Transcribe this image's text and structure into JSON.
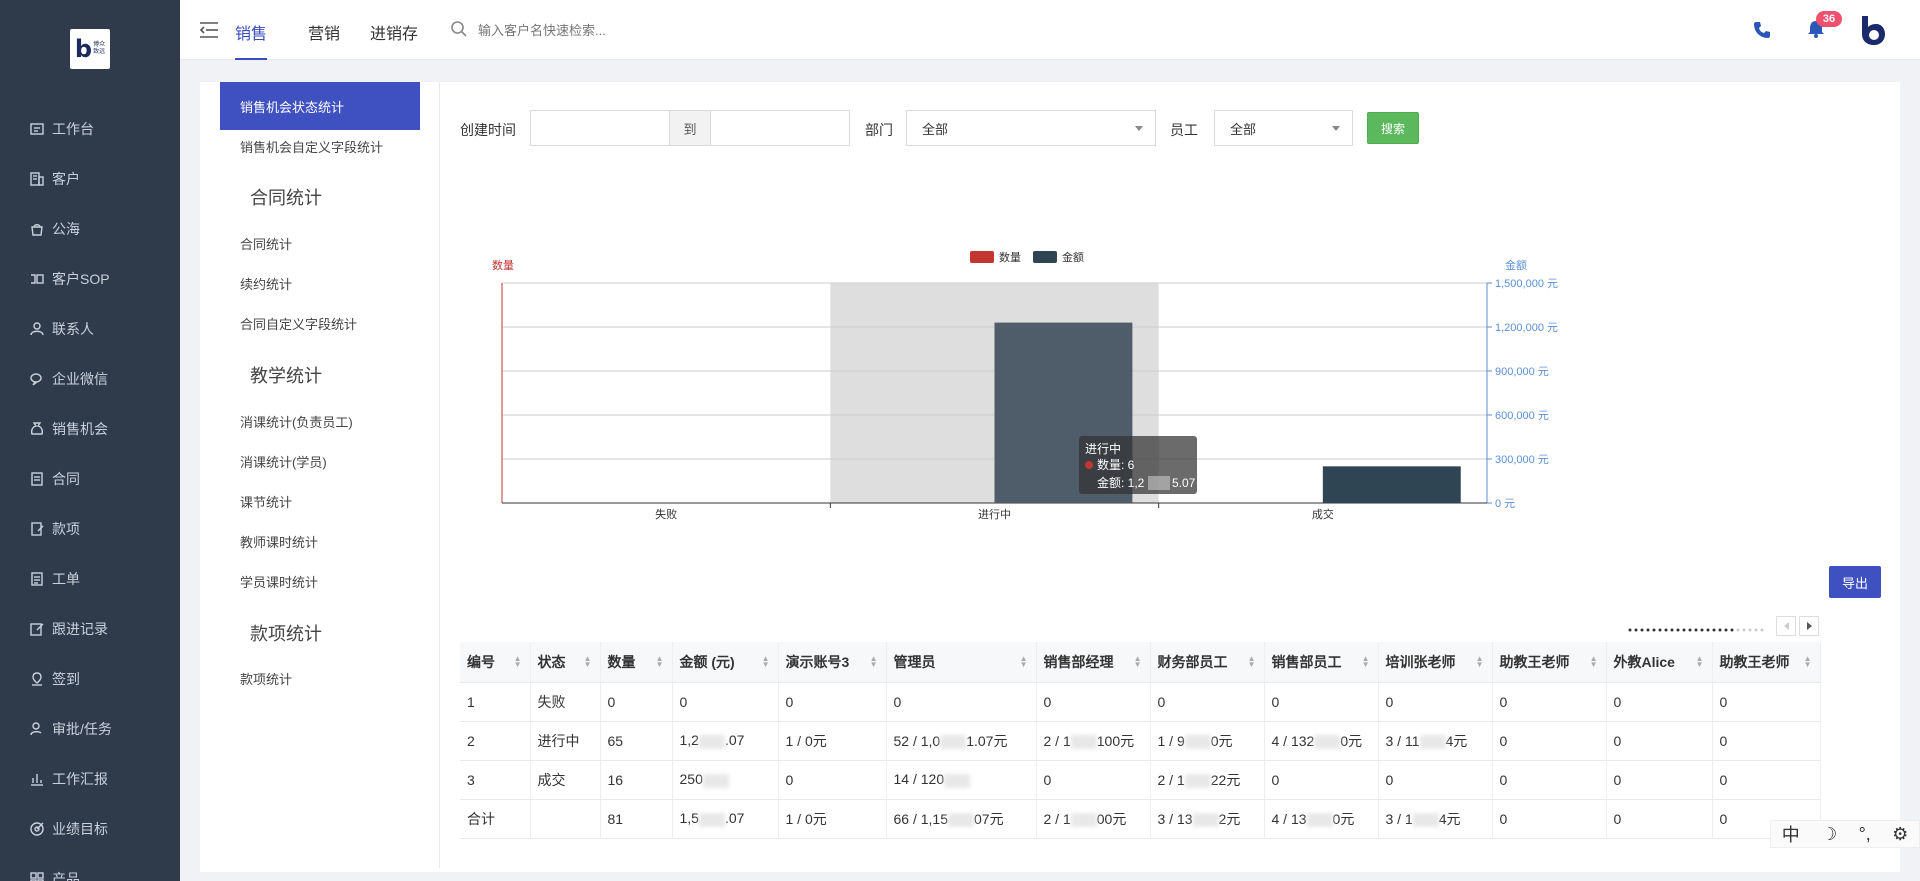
{
  "brand": {
    "logo_letter": "b",
    "logo_line1": "博众",
    "logo_line2": "致远"
  },
  "sidebar": {
    "items": [
      {
        "label": "工作台",
        "icon": "dashboard-icon"
      },
      {
        "label": "客户",
        "icon": "building-icon"
      },
      {
        "label": "公海",
        "icon": "pool-icon"
      },
      {
        "label": "客户SOP",
        "icon": "sop-icon"
      },
      {
        "label": "联系人",
        "icon": "contact-icon"
      },
      {
        "label": "企业微信",
        "icon": "wechat-icon"
      },
      {
        "label": "销售机会",
        "icon": "money-bag-icon"
      },
      {
        "label": "合同",
        "icon": "contract-icon"
      },
      {
        "label": "款项",
        "icon": "payment-icon"
      },
      {
        "label": "工单",
        "icon": "ticket-icon"
      },
      {
        "label": "跟进记录",
        "icon": "edit-icon"
      },
      {
        "label": "签到",
        "icon": "checkin-icon"
      },
      {
        "label": "审批/任务",
        "icon": "approval-icon"
      },
      {
        "label": "工作汇报",
        "icon": "report-icon"
      },
      {
        "label": "业绩目标",
        "icon": "target-icon"
      },
      {
        "label": "产品",
        "icon": "grid-icon"
      }
    ]
  },
  "topbar": {
    "tabs": [
      "销售",
      "营销",
      "进销存"
    ],
    "active_tab": 0,
    "search_placeholder": "输入客户名快速检索...",
    "notification_count": "36"
  },
  "subnav": {
    "items_top": [
      "销售机会状态统计",
      "销售机会自定义字段统计"
    ],
    "section_contract": "合同统计",
    "items_contract": [
      "合同统计",
      "续约统计",
      "合同自定义字段统计"
    ],
    "section_teaching": "教学统计",
    "items_teaching": [
      "消课统计(负责员工)",
      "消课统计(学员)",
      "课节统计",
      "教师课时统计",
      "学员课时统计"
    ],
    "section_payment": "款项统计",
    "items_payment": [
      "款项统计"
    ]
  },
  "filters": {
    "created_label": "创建时间",
    "to_label": "到",
    "dept_label": "部门",
    "dept_value": "全部",
    "staff_label": "员工",
    "staff_value": "全部",
    "search_button": "搜索"
  },
  "export_button": "导出",
  "chart_data": {
    "type": "bar",
    "categories": [
      "失败",
      "进行中",
      "成交"
    ],
    "series": [
      {
        "name": "数量",
        "color": "#c23531",
        "axis": "left",
        "values": [
          0,
          65,
          16
        ]
      },
      {
        "name": "金额",
        "color": "#2f4554",
        "axis": "right",
        "values": [
          0,
          1230000,
          250000
        ]
      }
    ],
    "left_axis_label": "数量",
    "right_axis_label": "金额",
    "right_ticks": [
      "0 元",
      "300,000 元",
      "600,000 元",
      "900,000 元",
      "1,200,000 元",
      "1,500,000 元"
    ],
    "right_ylim": [
      0,
      1500000
    ],
    "highlighted_category": "进行中",
    "tooltip": {
      "title": "进行中",
      "line1": "数量: 6",
      "line2": "金额: 1,2",
      "line2_tail": "5.07"
    }
  },
  "table": {
    "headers": [
      "编号",
      "状态",
      "数量",
      "金额 (元)",
      "演示账号3",
      "管理员",
      "销售部经理",
      "财务部员工",
      "销售部员工",
      "培训张老师",
      "助教王老师",
      "外教Alice",
      "助教王老师"
    ],
    "rows": [
      [
        "1",
        "失败",
        "0",
        "0",
        "0",
        "0",
        "0",
        "0",
        "0",
        "0",
        "0",
        "0",
        "0"
      ],
      [
        "2",
        "进行中",
        "65",
        "1,2▒.07",
        "1 / 0元",
        "52 / 1,0▒1.07元",
        "2 / 1▒100元",
        "1 / 9▒0元",
        "4 / 132▒0元",
        "3 / 11▒4元",
        "0",
        "0",
        "0"
      ],
      [
        "3",
        "成交",
        "16",
        "250▒",
        "0",
        "14 / 120▒",
        "0",
        "2 / 1▒22元",
        "0",
        "0",
        "0",
        "0",
        "0"
      ],
      [
        "合计",
        "",
        "81",
        "1,5▒.07",
        "1 / 0元",
        "66 / 1,15▒07元",
        "2 / 1▒00元",
        "3 / 13▒2元",
        "4 / 13▒0元",
        "3 / 1▒4元",
        "0",
        "0",
        "0"
      ]
    ]
  },
  "ime_toolbar": [
    "中",
    "☽",
    "°,",
    "⚙"
  ]
}
